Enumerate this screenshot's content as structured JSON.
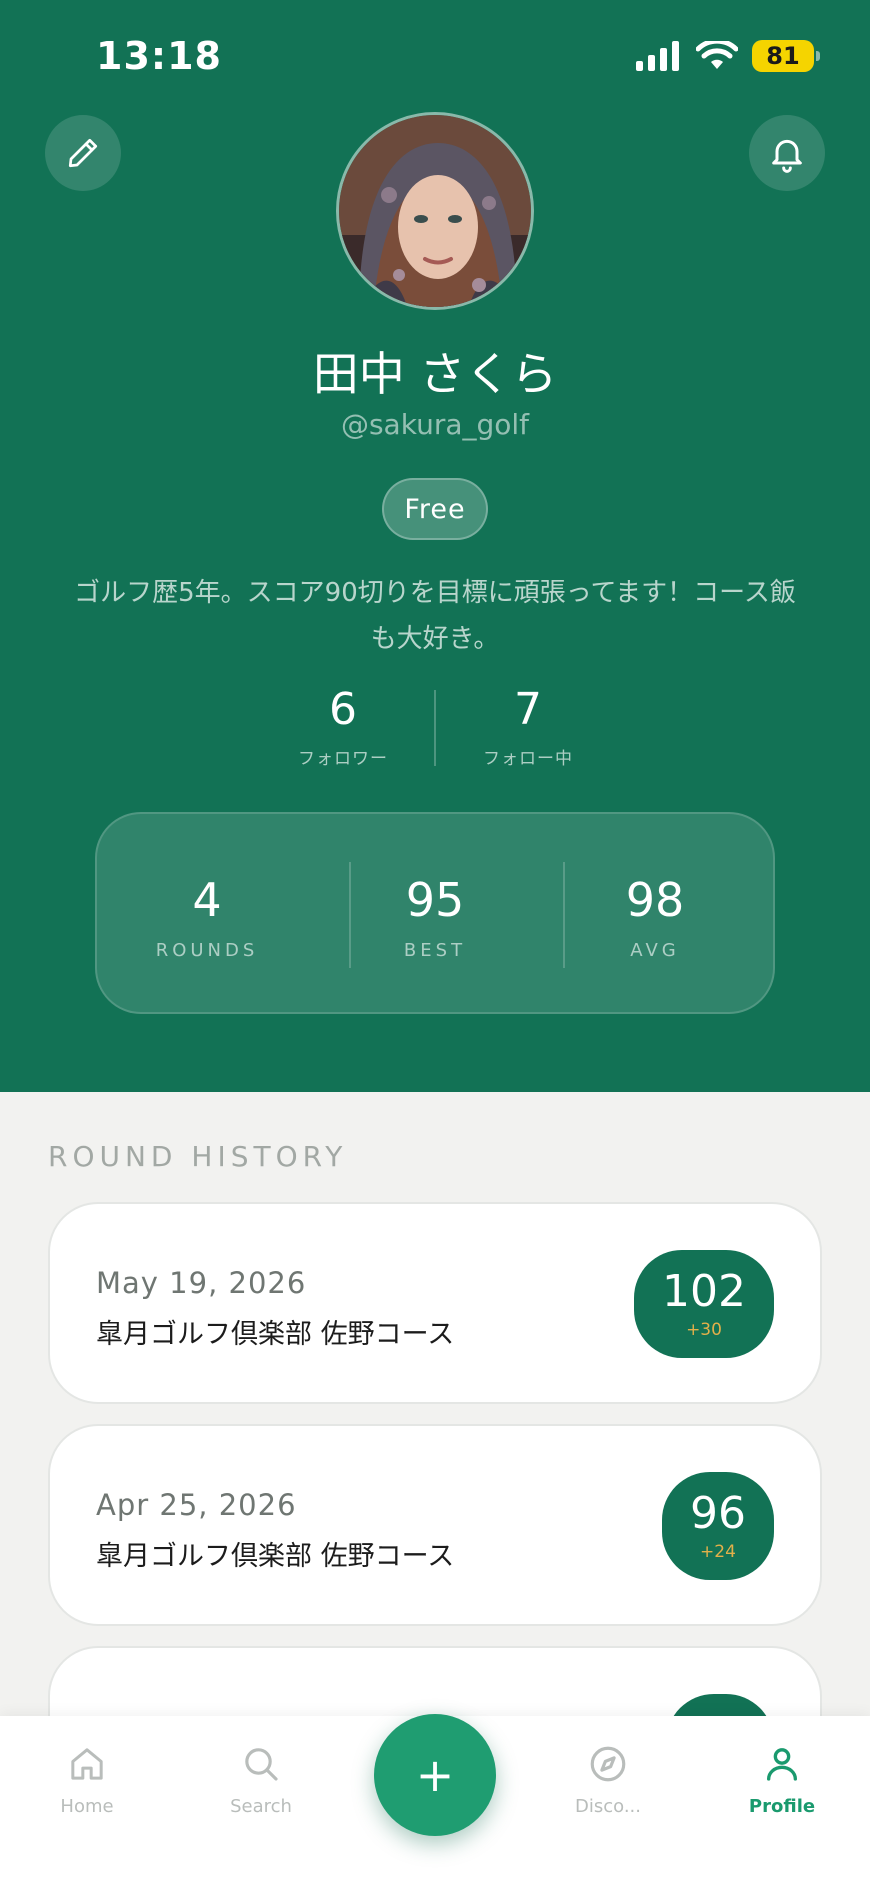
{
  "status_bar": {
    "time": "13:18",
    "battery": "81"
  },
  "profile": {
    "name": "田中 さくら",
    "handle": "@sakura_golf",
    "plan": "Free",
    "bio": "ゴルフ歴5年。スコア90切りを目標に頑張ってます！コース飯も大好き。",
    "followers": {
      "count": "6",
      "label": "フォロワー"
    },
    "following": {
      "count": "7",
      "label": "フォロー中"
    }
  },
  "stats": [
    {
      "value": "4",
      "label": "ROUNDS"
    },
    {
      "value": "95",
      "label": "BEST"
    },
    {
      "value": "98",
      "label": "AVG"
    }
  ],
  "round_history": {
    "title": "ROUND HISTORY",
    "rounds": [
      {
        "date": "May 19, 2026",
        "course": "皐月ゴルフ倶楽部 佐野コース",
        "score": "102",
        "diff": "+30"
      },
      {
        "date": "Apr 25, 2026",
        "course": "皐月ゴルフ倶楽部 佐野コース",
        "score": "96",
        "diff": "+24"
      }
    ]
  },
  "tab_bar": {
    "tabs": [
      {
        "label": "Home",
        "icon": "home-icon"
      },
      {
        "label": "Search",
        "icon": "search-icon"
      },
      {
        "label": "Disco...",
        "icon": "compass-icon"
      },
      {
        "label": "Profile",
        "icon": "person-icon",
        "active": true
      }
    ],
    "fab_label": "+"
  },
  "colors": {
    "primary": "#127255",
    "accent": "#1f9d71",
    "score_diff": "#e2b04a",
    "background": "#f2f2f0",
    "battery": "#f5d400"
  }
}
